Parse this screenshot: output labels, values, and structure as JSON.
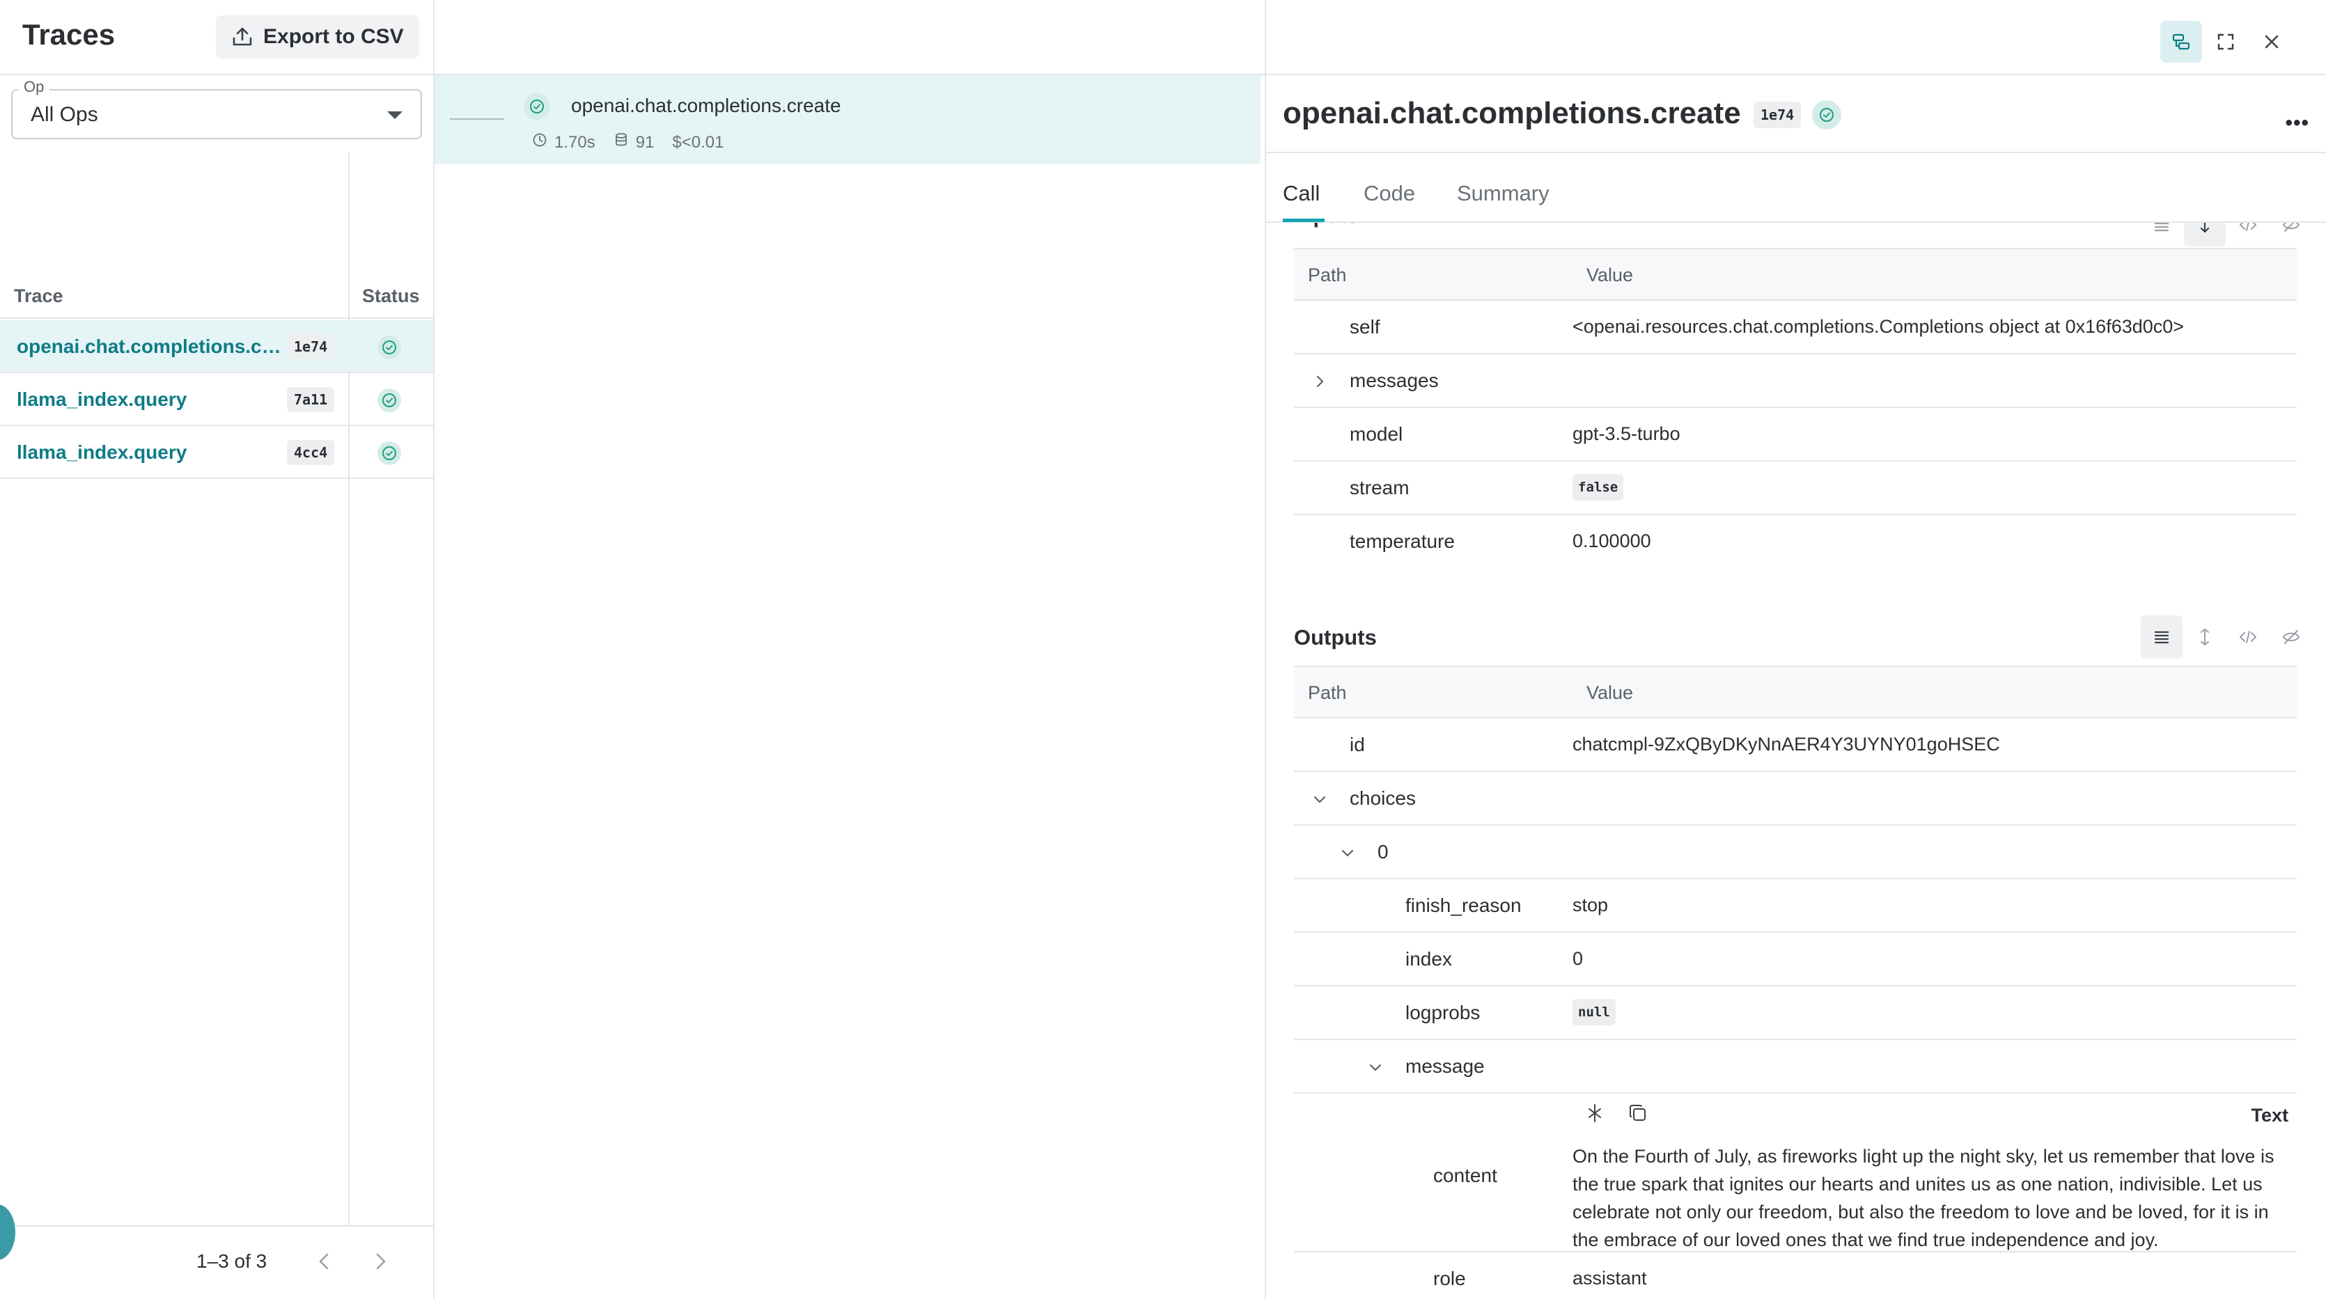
{
  "app": {
    "title": "Traces",
    "export_label": "Export to CSV"
  },
  "filter": {
    "label": "Op",
    "value": "All Ops"
  },
  "grid": {
    "columns": [
      "Trace",
      "Status"
    ],
    "rows": [
      {
        "name": "openai.chat.completions.create",
        "badge": "1e74",
        "status": "success"
      },
      {
        "name": "llama_index.query",
        "badge": "7a11",
        "status": "success"
      },
      {
        "name": "llama_index.query",
        "badge": "4cc4",
        "status": "success"
      }
    ]
  },
  "pager": {
    "text": "1–3 of 3"
  },
  "call_tree": {
    "name": "openai.chat.completions.create",
    "latency": "1.70s",
    "tokens": "91",
    "cost": "$<0.01"
  },
  "detail": {
    "title": "openai.chat.completions.create",
    "badge": "1e74",
    "more": "•••",
    "tabs": [
      "Call",
      "Code",
      "Summary"
    ],
    "inputs": {
      "title": "Inputs",
      "headers": [
        "Path",
        "Value"
      ],
      "rows": [
        {
          "key": "self",
          "value": "<openai.resources.chat.completions.Completions object at 0x16f63d0c0>"
        },
        {
          "key": "messages",
          "value": ""
        },
        {
          "key": "model",
          "value": "gpt-3.5-turbo"
        },
        {
          "key": "stream",
          "value": "false"
        },
        {
          "key": "temperature",
          "value": "0.100000"
        }
      ]
    },
    "outputs": {
      "title": "Outputs",
      "headers": [
        "Path",
        "Value"
      ],
      "rows": [
        {
          "key": "id",
          "value": "chatcmpl-9ZxQByDKyNnAER4Y3UYNY01goHSEC"
        },
        {
          "key": "choices",
          "value": ""
        },
        {
          "key": "0",
          "value": ""
        },
        {
          "key": "finish_reason",
          "value": "stop"
        },
        {
          "key": "index",
          "value": "0"
        },
        {
          "key": "logprobs",
          "value": "null"
        },
        {
          "key": "message",
          "value": ""
        },
        {
          "key": "content",
          "value": "On the Fourth of July, as fireworks light up the night sky, let us remember that love is the true spark that ignites our hearts and unites us as one nation, indivisible. Let us celebrate not only our freedom, but also the freedom to love and be loved, for it is in the embrace of our loved ones that we find true independence and joy."
        },
        {
          "key": "role",
          "value": "assistant"
        }
      ],
      "text_mode_label": "Text"
    }
  },
  "colors": {
    "accent": "#15a3b3",
    "link": "#0e7c86",
    "selected_row": "#e5f4f5",
    "success": "#1f9e83"
  },
  "icons": {
    "export": "upload-icon",
    "status": "check-circle-icon",
    "latency": "clock-icon",
    "tokens": "database-icon",
    "toolbar": [
      "tree-view-icon",
      "fullscreen-icon",
      "close-icon"
    ]
  }
}
